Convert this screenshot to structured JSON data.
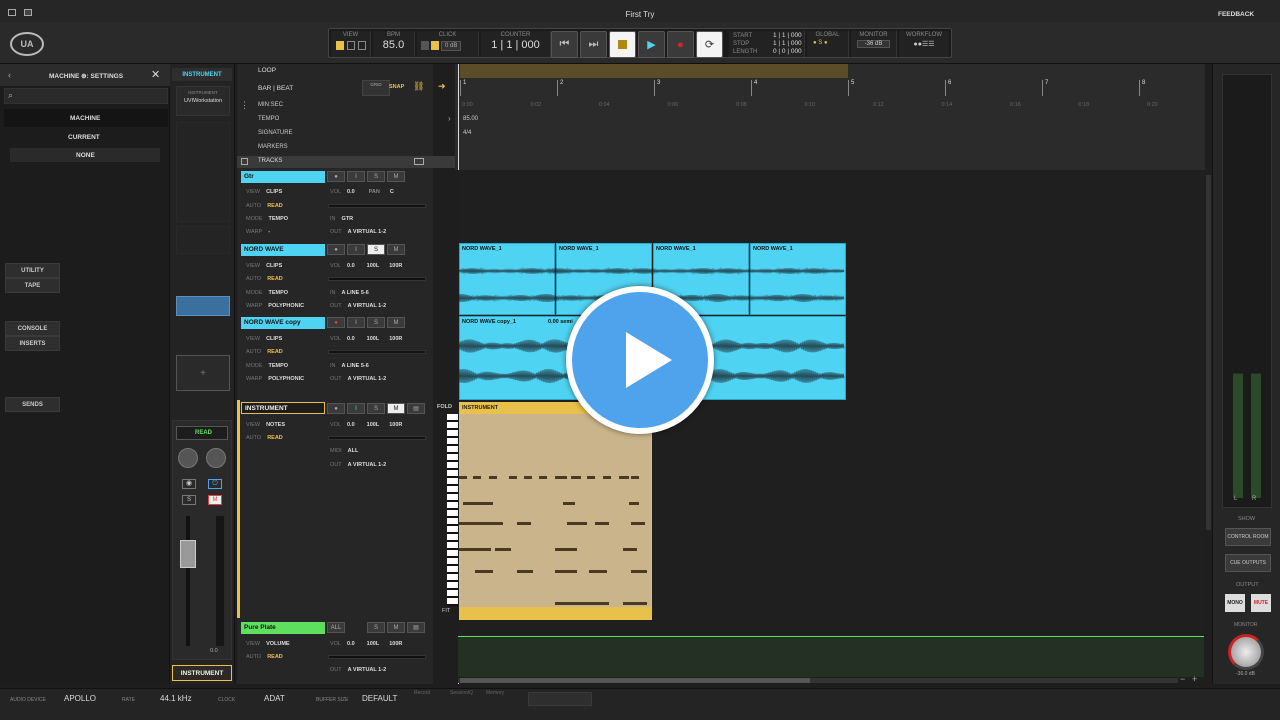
{
  "window": {
    "title": "First Try",
    "feedback": "FEEDBACK"
  },
  "transport": {
    "view_label": "VIEW",
    "bpm_label": "BPM",
    "bpm": "85.0",
    "click_label": "CLICK",
    "click_db": "0 dB",
    "counter_label": "COUNTER",
    "counter": "1 | 1 | 000",
    "start_label": "START",
    "stop_label": "STOP",
    "length_label": "LENGTH",
    "start": "1 | 1 | 000",
    "stop": "1 | 1 | 000",
    "length": "0 | 0 | 000",
    "global_label": "GLOBAL",
    "monitor_label": "MONITOR",
    "monitor_db": "-36 dB",
    "workflow_label": "WORKFLOW"
  },
  "left_panel": {
    "title": "MACHINE ⊕: SETTINGS",
    "machine": "MACHINE",
    "current": "CURRENT",
    "none": "NONE"
  },
  "inspector": {
    "instrument": "INSTRUMENT",
    "preset_label": "INSTRUMENT",
    "preset": "UVIWorkstation",
    "sidechain": "ALL",
    "utility": "UTILITY",
    "tape": "TAPE",
    "console": "CONSOLE",
    "inserts": "INSERTS",
    "sends": "SENDS",
    "read": "READ",
    "s": "S",
    "m": "M",
    "fader_val": "0.0",
    "channel_name": "INSTRUMENT",
    "midi_in": "NONE"
  },
  "ruler": {
    "loop": "LOOP",
    "barbeat": "BAR | BEAT",
    "grid": "GRID",
    "snap": "SNAP",
    "minsec": "MIN:SEC",
    "tempo": "TEMPO",
    "tempo_val": "85.00",
    "signature": "SIGNATURE",
    "sig_val": "4/4",
    "markers": "MARKERS",
    "tracks": "TRACKS",
    "bars": [
      "1",
      "2",
      "3",
      "4",
      "5",
      "6",
      "7",
      "8"
    ],
    "times": [
      "0:00",
      "0:02",
      "0:04",
      "0:06",
      "0:08",
      "0:10",
      "0:12",
      "0:14",
      "0:16",
      "0:18",
      "0:20"
    ]
  },
  "tracks": [
    {
      "name": "Gtr",
      "view": "CLIPS",
      "auto": "READ",
      "mode": "TEMPO",
      "warp": "-",
      "vol": "0.0",
      "pan": "PAN",
      "pan_val": "C",
      "in": "GTR",
      "out": "A VIRTUAL 1-2",
      "color": "#4fd3f2"
    },
    {
      "name": "NORD WAVE",
      "view": "CLIPS",
      "auto": "READ",
      "mode": "TEMPO",
      "warp": "POLYPHONIC",
      "vol": "0.0",
      "pan": "100L",
      "pan_val": "100R",
      "in": "A LINE 5-6",
      "out": "A VIRTUAL 1-2",
      "color": "#4fd3f2"
    },
    {
      "name": "NORD WAVE copy",
      "view": "CLIPS",
      "auto": "READ",
      "mode": "TEMPO",
      "warp": "POLYPHONIC",
      "vol": "0.0",
      "pan": "100L",
      "pan_val": "100R",
      "in": "A LINE 5-6",
      "out": "A VIRTUAL 1-2",
      "color": "#4fd3f2"
    },
    {
      "name": "INSTRUMENT",
      "view": "NOTES",
      "auto": "READ",
      "vol": "0.0",
      "pan": "100L",
      "pan_val": "100R",
      "midi": "ALL",
      "out": "A VIRTUAL 1-2",
      "color": "#e8c14a"
    },
    {
      "name": "Pure Plate",
      "view": "VOLUME",
      "auto": "READ",
      "vol": "0.0",
      "pan": "100L",
      "pan_val": "100R",
      "out": "A VIRTUAL 1-2",
      "color": "#5ee05e"
    }
  ],
  "row_labels": {
    "view": "VIEW",
    "auto": "AUTO",
    "mode": "MODE",
    "warp": "WARP",
    "vol": "VOL",
    "in": "IN",
    "out": "OUT",
    "midi": "MIDI",
    "fold": "FOLD",
    "fit": "FIT"
  },
  "clips": {
    "nord": [
      "NORD WAVE_1",
      "NORD WAVE_1",
      "NORD WAVE_1",
      "NORD WAVE_1"
    ],
    "nord_copy": "NORD WAVE copy_1",
    "nord_copy_sub": "0.00 semi",
    "instrument": "INSTRUMENT"
  },
  "right_panel": {
    "show": "SHOW",
    "control_room": "CONTROL ROOM",
    "cue_outputs": "CUE OUTPUTS",
    "output": "OUTPUT",
    "mono": "MONO",
    "mute": "MUTE",
    "monitor": "MONITOR",
    "monitor_val": "-36.0 dB",
    "l": "L",
    "r": "R"
  },
  "status": {
    "audio_device_label": "AUDIO DEVICE",
    "audio_device": "APOLLO",
    "rate_label": "RATE",
    "rate": "44.1 kHz",
    "clock_label": "CLOCK",
    "clock": "ADAT",
    "buffer_label": "BUFFER SIZE",
    "buffer": "DEFAULT",
    "record_label": "Record",
    "session_label": "Session/Q",
    "memory_label": "Memory"
  }
}
